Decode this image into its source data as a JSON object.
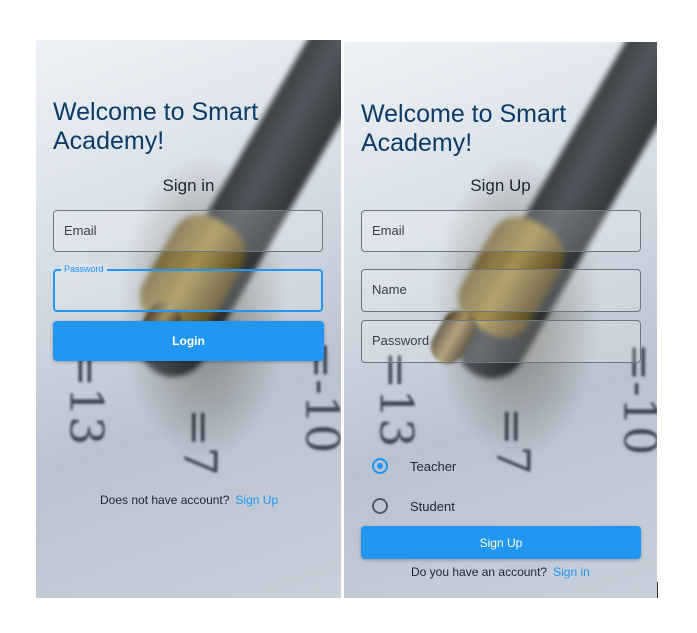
{
  "signin": {
    "title_line1": "Welcome to Smart",
    "title_line2": "Academy!",
    "heading": "Sign in",
    "email_placeholder": "Email",
    "password_label": "Password",
    "login_label": "Login",
    "footer_text": "Does not have account?",
    "footer_link": "Sign Up"
  },
  "signup": {
    "title_line1": "Welcome to Smart",
    "title_line2": "Academy!",
    "heading": "Sign Up",
    "email_placeholder": "Email",
    "name_placeholder": "Name",
    "password_placeholder": "Password",
    "role_options": [
      "Teacher",
      "Student"
    ],
    "selected_role": "Teacher",
    "button_label": "Sign Up",
    "footer_text": "Do you have an account?",
    "footer_link": "Sign in"
  },
  "background_math": [
    "=13",
    "=7",
    "=-10"
  ],
  "colors": {
    "accent": "#2196f3",
    "title": "#0e3a66"
  }
}
